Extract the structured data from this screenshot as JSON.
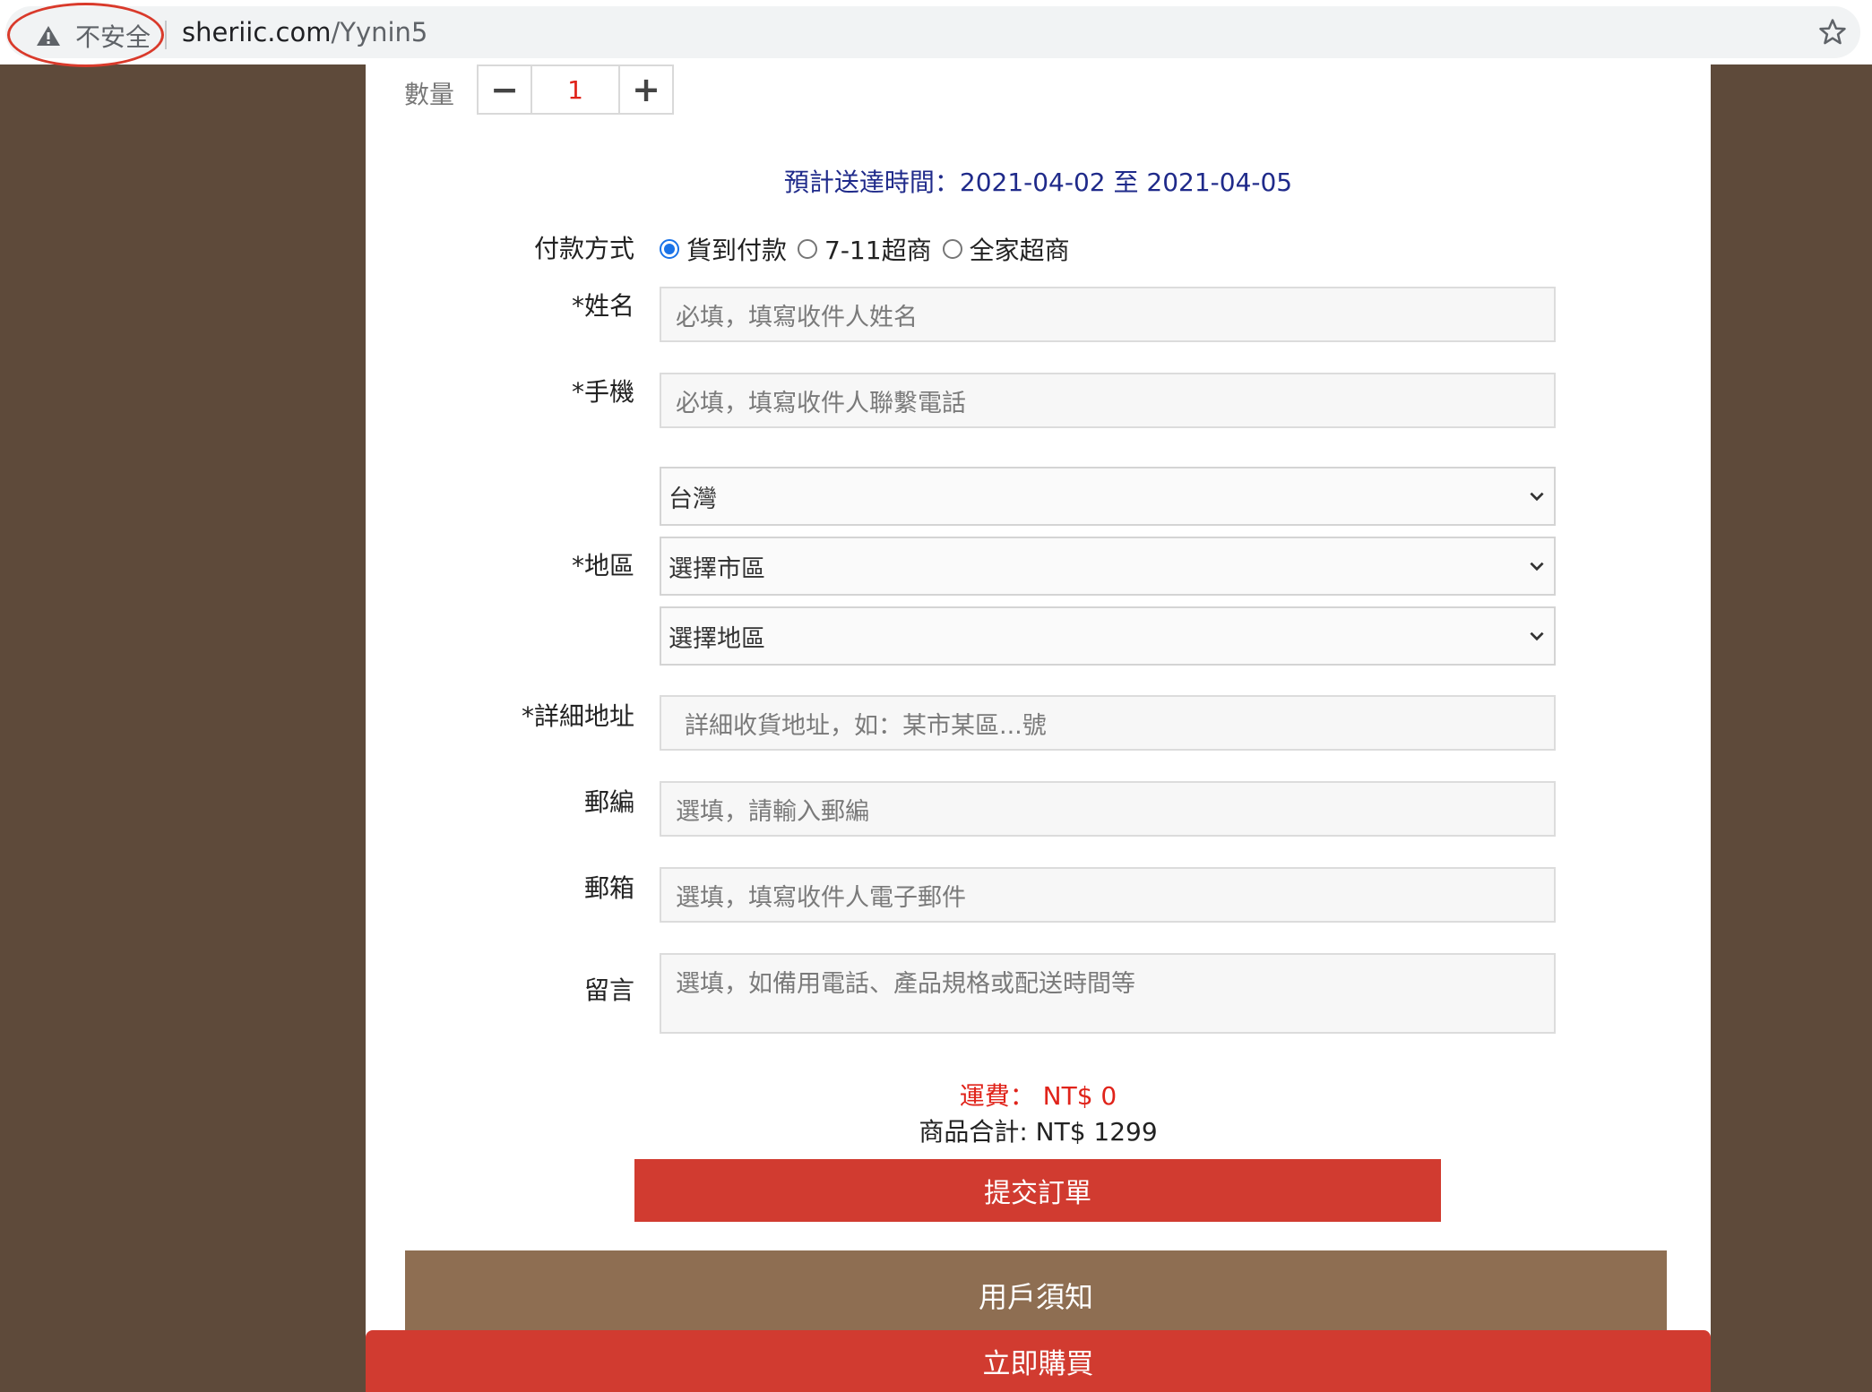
{
  "browser": {
    "security_label": "不安全",
    "url_host": "sheriic.com",
    "url_path": "/Yynin5",
    "colors": {
      "annotation_circle": "#d93a2b"
    }
  },
  "quantity": {
    "label": "數量",
    "minus": "−",
    "value": "1",
    "plus": "+"
  },
  "eta": "預計送達時間：2021-04-02 至 2021-04-05",
  "payment": {
    "label": "付款方式",
    "options": [
      {
        "label": "貨到付款",
        "selected": true
      },
      {
        "label": "7-11超商",
        "selected": false
      },
      {
        "label": "全家超商",
        "selected": false
      }
    ]
  },
  "form": {
    "name": {
      "label": "*姓名",
      "placeholder": "必填，填寫收件人姓名"
    },
    "phone": {
      "label": "*手機",
      "placeholder": "必填，填寫收件人聯繫電話"
    },
    "region": {
      "label": "*地區",
      "country": "台灣",
      "city": "選擇市區",
      "district": "選擇地區"
    },
    "address": {
      "label": "*詳細地址",
      "placeholder": "詳細收貨地址，如：某市某區...號"
    },
    "zipcode": {
      "label": "郵編",
      "placeholder": "選填，請輸入郵編"
    },
    "email": {
      "label": "郵箱",
      "placeholder": "選填，填寫收件人電子郵件"
    },
    "message": {
      "label": "留言",
      "placeholder": "選填，如備用電話、產品規格或配送時間等"
    }
  },
  "summary": {
    "shipping": "運費： NT$ 0",
    "total": "商品合計: NT$ 1299"
  },
  "buttons": {
    "submit": "提交訂單",
    "notice": "用戶須知",
    "buy_now": "立即購買"
  },
  "colors": {
    "background": "#5e4a3a",
    "accent_red": "#d13b30",
    "notice_brown": "#8e6e52",
    "eta_blue": "#1f2a8a",
    "radio_blue": "#1a73e8"
  }
}
